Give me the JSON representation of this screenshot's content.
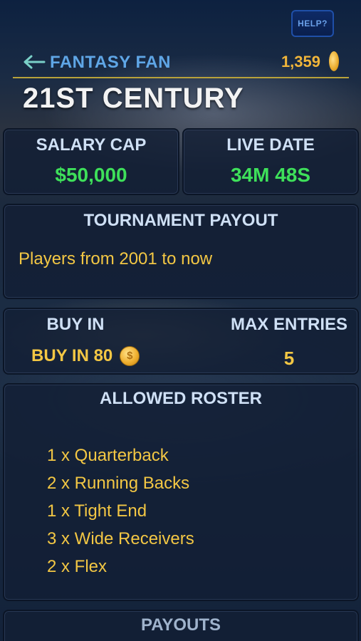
{
  "help_button": {
    "label": "HELP?"
  },
  "header": {
    "title": "FANTASY FAN",
    "coins": "1,359"
  },
  "page_title": "21ST CENTURY",
  "salary_cap": {
    "label": "SALARY CAP",
    "value": "$50,000"
  },
  "live_date": {
    "label": "LIVE DATE",
    "value": "34M 48S"
  },
  "tournament_payout": {
    "label": "TOURNAMENT PAYOUT",
    "description": "Players from 2001 to now"
  },
  "buy_in": {
    "label": "BUY IN",
    "value_label": "BUY IN 80",
    "coin_symbol": "$"
  },
  "max_entries": {
    "label": "MAX ENTRIES",
    "value": "5"
  },
  "allowed_roster": {
    "label": "ALLOWED ROSTER",
    "items": [
      "1 x Quarterback",
      "2 x Running Backs",
      "1 x Tight End",
      "3 x Wide Receivers",
      "2 x Flex"
    ]
  },
  "payouts": {
    "label": "PAYOUTS"
  },
  "colors": {
    "accent_blue": "#5fa6e6",
    "gold": "#f3c744",
    "green": "#3ee05a"
  }
}
